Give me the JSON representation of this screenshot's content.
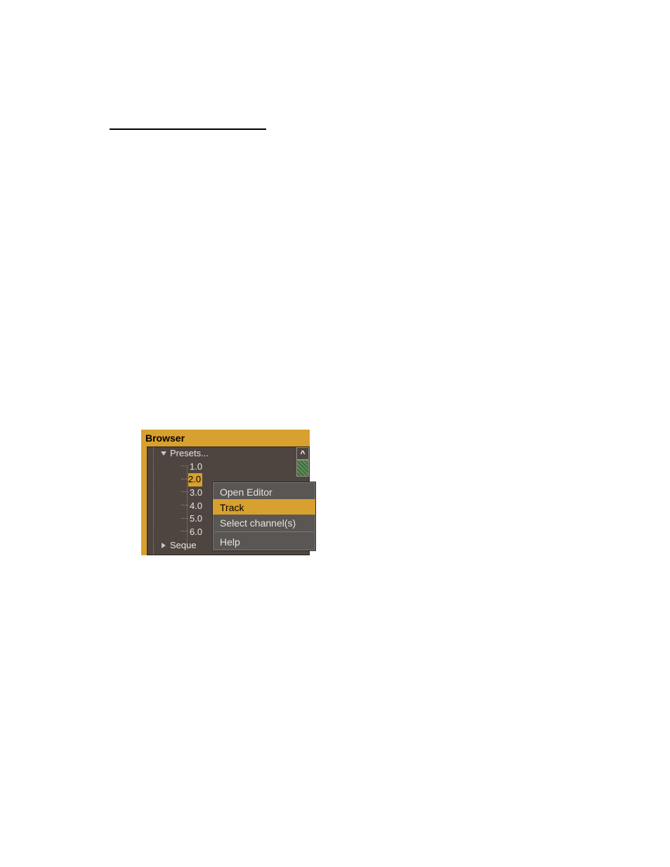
{
  "browser_panel": {
    "title": "Browser",
    "presets_label": "Presets...",
    "items": [
      "1.0",
      "2.0",
      "3.0",
      "4.0",
      "5.0",
      "6.0"
    ],
    "sequence_label": "Seque",
    "selected_index": 1
  },
  "scrollbar": {
    "up_glyph": "^"
  },
  "context_menu": {
    "items": [
      "Open Editor",
      "Track",
      "Select channel(s)"
    ],
    "footer_item": "Help",
    "highlighted_index": 1
  },
  "icons": {
    "triangle_down": "triangle-down-icon",
    "triangle_right": "triangle-right-icon"
  }
}
